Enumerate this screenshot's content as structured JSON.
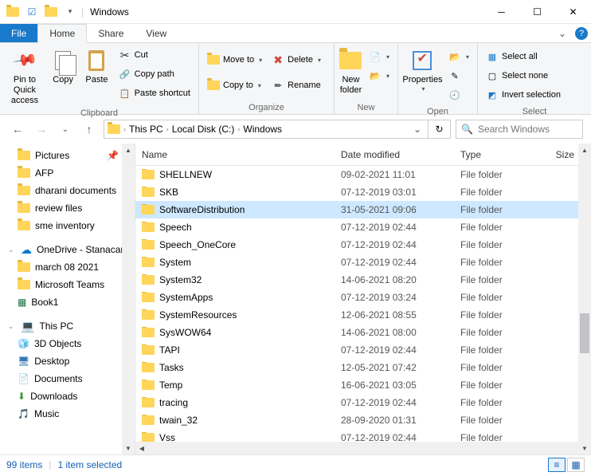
{
  "title": "Windows",
  "tabs": {
    "file": "File",
    "home": "Home",
    "share": "Share",
    "view": "View"
  },
  "ribbon": {
    "clipboard": {
      "label": "Clipboard",
      "pin": "Pin to Quick\naccess",
      "copy": "Copy",
      "paste": "Paste",
      "cut": "Cut",
      "copypath": "Copy path",
      "pasteshortcut": "Paste shortcut"
    },
    "organize": {
      "label": "Organize",
      "moveto": "Move to",
      "copyto": "Copy to",
      "delete": "Delete",
      "rename": "Rename"
    },
    "new": {
      "label": "New",
      "newfolder": "New\nfolder"
    },
    "open": {
      "label": "Open",
      "properties": "Properties"
    },
    "select": {
      "label": "Select",
      "all": "Select all",
      "none": "Select none",
      "invert": "Invert selection"
    }
  },
  "breadcrumb": {
    "thispc": "This PC",
    "disk": "Local Disk (C:)",
    "folder": "Windows"
  },
  "search": {
    "placeholder": "Search Windows"
  },
  "columns": {
    "name": "Name",
    "date": "Date modified",
    "type": "Type",
    "size": "Size"
  },
  "sidebar": {
    "pictures": "Pictures",
    "afp": "AFP",
    "dharani": "dharani documents",
    "review": "review files",
    "sme": "sme inventory",
    "onedrive": "OneDrive - Stanacard",
    "march": "march 08 2021",
    "teams": "Microsoft Teams",
    "book1": "Book1",
    "thispc": "This PC",
    "objects3d": "3D Objects",
    "desktop": "Desktop",
    "documents": "Documents",
    "downloads": "Downloads",
    "music": "Music"
  },
  "files": [
    {
      "name": "SHELLNEW",
      "date": "09-02-2021 11:01",
      "type": "File folder",
      "sel": false
    },
    {
      "name": "SKB",
      "date": "07-12-2019 03:01",
      "type": "File folder",
      "sel": false
    },
    {
      "name": "SoftwareDistribution",
      "date": "31-05-2021 09:06",
      "type": "File folder",
      "sel": true
    },
    {
      "name": "Speech",
      "date": "07-12-2019 02:44",
      "type": "File folder",
      "sel": false
    },
    {
      "name": "Speech_OneCore",
      "date": "07-12-2019 02:44",
      "type": "File folder",
      "sel": false
    },
    {
      "name": "System",
      "date": "07-12-2019 02:44",
      "type": "File folder",
      "sel": false
    },
    {
      "name": "System32",
      "date": "14-06-2021 08:20",
      "type": "File folder",
      "sel": false
    },
    {
      "name": "SystemApps",
      "date": "07-12-2019 03:24",
      "type": "File folder",
      "sel": false
    },
    {
      "name": "SystemResources",
      "date": "12-06-2021 08:55",
      "type": "File folder",
      "sel": false
    },
    {
      "name": "SysWOW64",
      "date": "14-06-2021 08:00",
      "type": "File folder",
      "sel": false
    },
    {
      "name": "TAPI",
      "date": "07-12-2019 02:44",
      "type": "File folder",
      "sel": false
    },
    {
      "name": "Tasks",
      "date": "12-05-2021 07:42",
      "type": "File folder",
      "sel": false
    },
    {
      "name": "Temp",
      "date": "16-06-2021 03:05",
      "type": "File folder",
      "sel": false
    },
    {
      "name": "tracing",
      "date": "07-12-2019 02:44",
      "type": "File folder",
      "sel": false
    },
    {
      "name": "twain_32",
      "date": "28-09-2020 01:31",
      "type": "File folder",
      "sel": false
    },
    {
      "name": "Vss",
      "date": "07-12-2019 02:44",
      "type": "File folder",
      "sel": false
    }
  ],
  "status": {
    "items": "99 items",
    "selected": "1 item selected"
  }
}
